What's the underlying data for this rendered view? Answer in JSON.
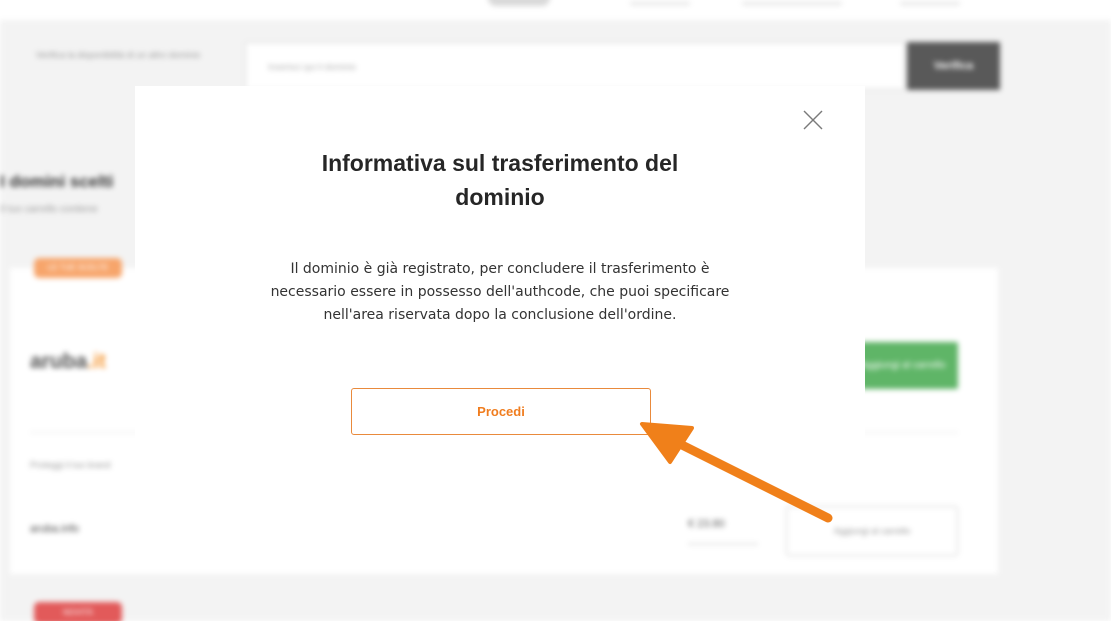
{
  "background": {
    "search": {
      "hint": "Verifica la disponibilità di un altro dominio",
      "placeholder": "Inserisci qui il dominio",
      "verify_label": "Verifica"
    },
    "section_title": "I domini scelti",
    "section_subtitle": "Il tuo carrello contiene",
    "badge_top": "LE TUE SCELTE",
    "logo": {
      "name": "aruba",
      "tld": ".it"
    },
    "cart_button_label": "Aggiungi al carrello",
    "protect_text": "Proteggi il tuo brand",
    "item_name": "aruba.info",
    "item_price": "€ 23.80",
    "add_cart_label": "Aggiungi al carrello",
    "badge_bottom": "NOVITÀ"
  },
  "modal": {
    "title_lines": [
      "Informativa sul trasferimento del",
      "dominio"
    ],
    "body_lines": [
      "Il dominio è già registrato, per concludere il trasferimento è",
      "necessario essere in possesso dell'authcode, che puoi specificare",
      "nell'area riservata dopo la conclusione dell'ordine."
    ],
    "proceed_label": "Procedi",
    "close_icon": "close-icon"
  },
  "annotation": {
    "icon": "pointer-arrow-icon",
    "color": "#f0801a"
  },
  "colors": {
    "accent": "#f07d1f",
    "text": "#262626",
    "overlay_bg": "#f3f3f3"
  }
}
